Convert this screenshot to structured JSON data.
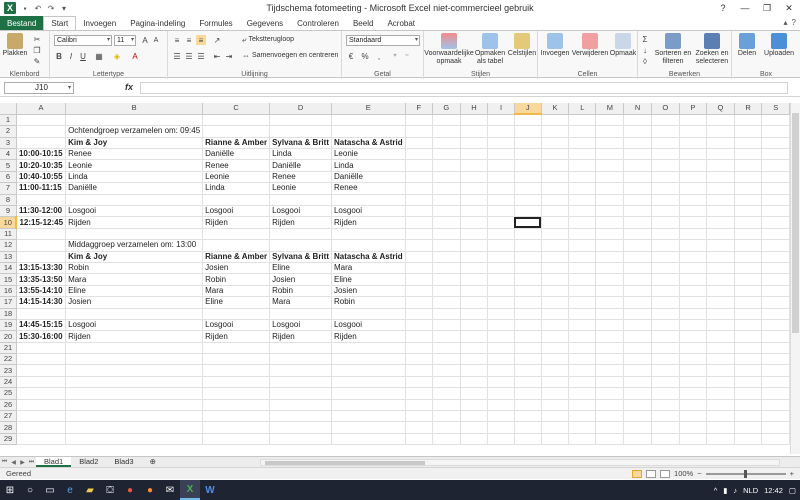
{
  "window": {
    "title": "Tijdschema fotomeeting  -  Microsoft Excel niet-commercieel gebruik"
  },
  "tabs": [
    "Bestand",
    "Start",
    "Invoegen",
    "Pagina-indeling",
    "Formules",
    "Gegevens",
    "Controleren",
    "Beeld",
    "Acrobat"
  ],
  "ribbon": {
    "plakken": "Plakken",
    "klembord": "Klembord",
    "font_name": "Calibri",
    "font_size": "11",
    "lettertype": "Lettertype",
    "tekstterugloop": "Tekstterugloop",
    "samenvoegen": "Samenvoegen en centreren",
    "uitlijning": "Uitlijning",
    "number_format": "Standaard",
    "getal": "Getal",
    "voorwaardelijke": "Voorwaardelijke opmaak",
    "opmaken_tabel": "Opmaken als tabel",
    "celstijlen": "Celstijlen",
    "stijlen": "Stijlen",
    "invoegen": "Invoegen",
    "verwijderen": "Verwijderen",
    "opmaak": "Opmaak",
    "cellen": "Cellen",
    "sorteren": "Sorteren en filteren",
    "zoeken": "Zoeken en selecteren",
    "bewerken": "Bewerken",
    "delen": "Delen",
    "uploaden": "Uploaden",
    "box": "Box"
  },
  "formula_bar": {
    "name_box": "J10",
    "fx": "fx",
    "content": ""
  },
  "columns": [
    "A",
    "B",
    "C",
    "D",
    "E",
    "F",
    "G",
    "H",
    "I",
    "J",
    "K",
    "L",
    "M",
    "N",
    "O",
    "P",
    "Q",
    "R",
    "S"
  ],
  "selected": {
    "column": "J",
    "row": 10
  },
  "rows": [
    [
      "",
      "",
      "",
      "",
      ""
    ],
    [
      "",
      "Ochtendgroep verzamelen om: 09:45",
      "",
      "",
      ""
    ],
    [
      "",
      "Kim & Joy",
      "Rianne & Amber",
      "Sylvana & Britt",
      "Natascha & Astrid"
    ],
    [
      "10:00-10:15",
      "Renee",
      "Daniëlle",
      "Linda",
      "Leonie"
    ],
    [
      "10:20-10:35",
      "Leonie",
      "Renee",
      "Daniëlle",
      "Linda"
    ],
    [
      "10:40-10:55",
      "Linda",
      "Leonie",
      "Renee",
      "Daniëlle"
    ],
    [
      "11:00-11:15",
      "Daniëlle",
      "Linda",
      "Leonie",
      "Renee"
    ],
    [
      "",
      "",
      "",
      "",
      ""
    ],
    [
      "11:30-12:00",
      "Losgooi",
      "Losgooi",
      "Losgooi",
      "Losgooi"
    ],
    [
      "12:15-12:45",
      "Rijden",
      "Rijden",
      "Rijden",
      "Rijden"
    ],
    [
      "",
      "",
      "",
      "",
      ""
    ],
    [
      "",
      "Middaggroep verzamelen om: 13:00",
      "",
      "",
      ""
    ],
    [
      "",
      "Kim & Joy",
      "Rianne & Amber",
      "Sylvana & Britt",
      "Natascha & Astrid"
    ],
    [
      "13:15-13:30",
      "Robin",
      "Josien",
      "Eline",
      "Mara"
    ],
    [
      "13:35-13:50",
      "Mara",
      "Robin",
      "Josien",
      "Eline"
    ],
    [
      "13:55-14:10",
      "Eline",
      "Mara",
      "Robin",
      "Josien"
    ],
    [
      "14:15-14:30",
      "Josien",
      "Eline",
      "Mara",
      "Robin"
    ],
    [
      "",
      "",
      "",
      "",
      ""
    ],
    [
      "14:45-15:15",
      "Losgooi",
      "Losgooi",
      "Losgooi",
      "Losgooi"
    ],
    [
      "15:30-16:00",
      "Rijden",
      "Rijden",
      "Rijden",
      "Rijden"
    ],
    [
      "",
      "",
      "",
      "",
      ""
    ],
    [
      "",
      "",
      "",
      "",
      ""
    ],
    [
      "",
      "",
      "",
      "",
      ""
    ],
    [
      "",
      "",
      "",
      "",
      ""
    ],
    [
      "",
      "",
      "",
      "",
      ""
    ],
    [
      "",
      "",
      "",
      "",
      ""
    ],
    [
      "",
      "",
      "",
      "",
      ""
    ],
    [
      "",
      "",
      "",
      "",
      ""
    ],
    [
      "",
      "",
      "",
      "",
      ""
    ]
  ],
  "sheets": [
    "Blad1",
    "Blad2",
    "Blad3"
  ],
  "active_sheet": "Blad1",
  "status": {
    "text": "Gereed",
    "zoom": "100%"
  },
  "taskbar": {
    "lang": "NLD",
    "time": "12:42"
  }
}
